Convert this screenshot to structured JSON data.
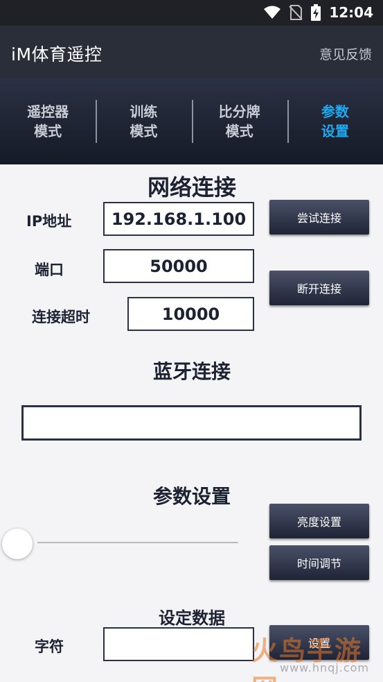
{
  "status_bar": {
    "time": "12:04"
  },
  "app_bar": {
    "title": "iM体育遥控",
    "feedback": "意见反馈"
  },
  "tabs": [
    {
      "line1": "遥控器",
      "line2": "模式"
    },
    {
      "line1": "训练",
      "line2": "模式"
    },
    {
      "line1": "比分牌",
      "line2": "模式"
    },
    {
      "line1": "参数",
      "line2": "设置"
    }
  ],
  "colors": {
    "active_tab": "#1eaaf1",
    "button_bg": "#2f3548",
    "header_bg": "#2a2e38"
  },
  "network": {
    "heading": "网络连接",
    "ip_label": "IP地址",
    "ip_value": "192.168.1.100",
    "port_label": "端口",
    "port_value": "50000",
    "timeout_label": "连接超时",
    "timeout_value": "10000",
    "connect_button": "尝试连接",
    "disconnect_button": "断开连接"
  },
  "bluetooth": {
    "heading": "蓝牙连接",
    "value": ""
  },
  "params": {
    "heading": "参数设置",
    "brightness_button": "亮度设置",
    "time_button": "时间调节",
    "slider_value": 0
  },
  "set_data": {
    "heading": "设定数据",
    "char_label": "字符",
    "char_value": "",
    "set_button": "设置"
  },
  "watermark": {
    "brand": "火鸟手游网",
    "url": "www.hnqj.com"
  }
}
